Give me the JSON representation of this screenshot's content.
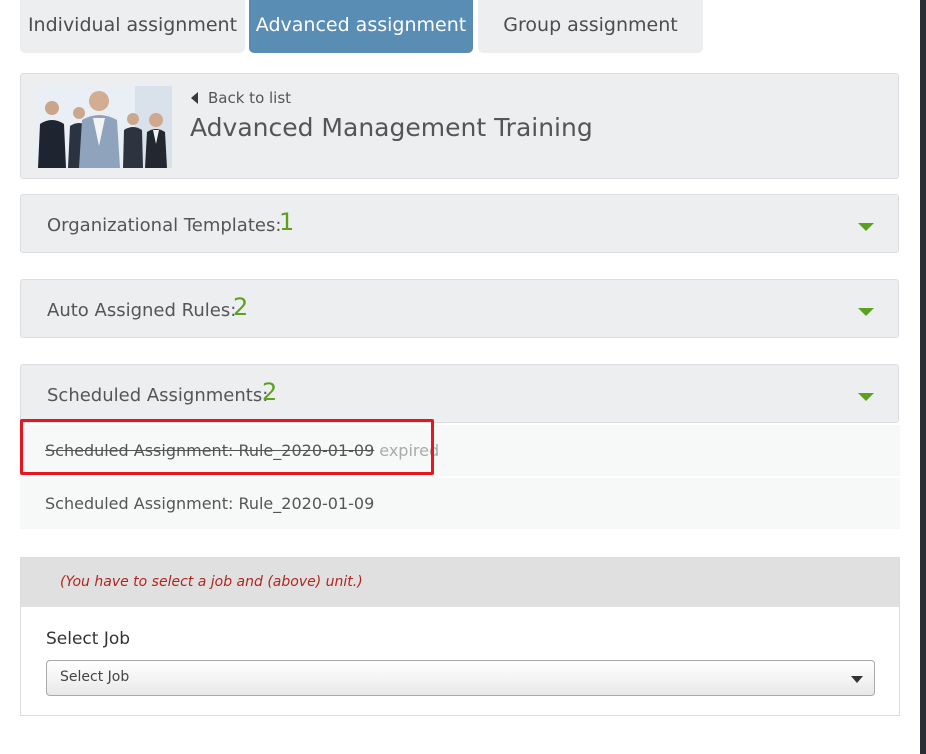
{
  "tabs": [
    {
      "label": "Individual assignment",
      "active": false
    },
    {
      "label": "Advanced assignment",
      "active": true
    },
    {
      "label": "Group assignment",
      "active": false
    }
  ],
  "course": {
    "back_label": "Back to list",
    "title": "Advanced Management Training"
  },
  "panels": [
    {
      "label": "Organizational Templates:",
      "count": "1"
    },
    {
      "label": "Auto Assigned Rules:",
      "count": "2"
    },
    {
      "label": "Scheduled Assignments:",
      "count": "2"
    }
  ],
  "scheduled": [
    {
      "name": "Scheduled Assignment: Rule_2020-01-09",
      "status": "expired"
    },
    {
      "name": "Scheduled Assignment: Rule_2020-01-09",
      "status": ""
    }
  ],
  "job": {
    "warning": "(You have to select a job and (above) unit.)",
    "label": "Select Job",
    "placeholder": "Select Job"
  },
  "colors": {
    "active_tab": "#5a8db3",
    "count_green": "#5aa21e",
    "highlight_red": "#e8141e",
    "warning_red": "#b0261d"
  }
}
